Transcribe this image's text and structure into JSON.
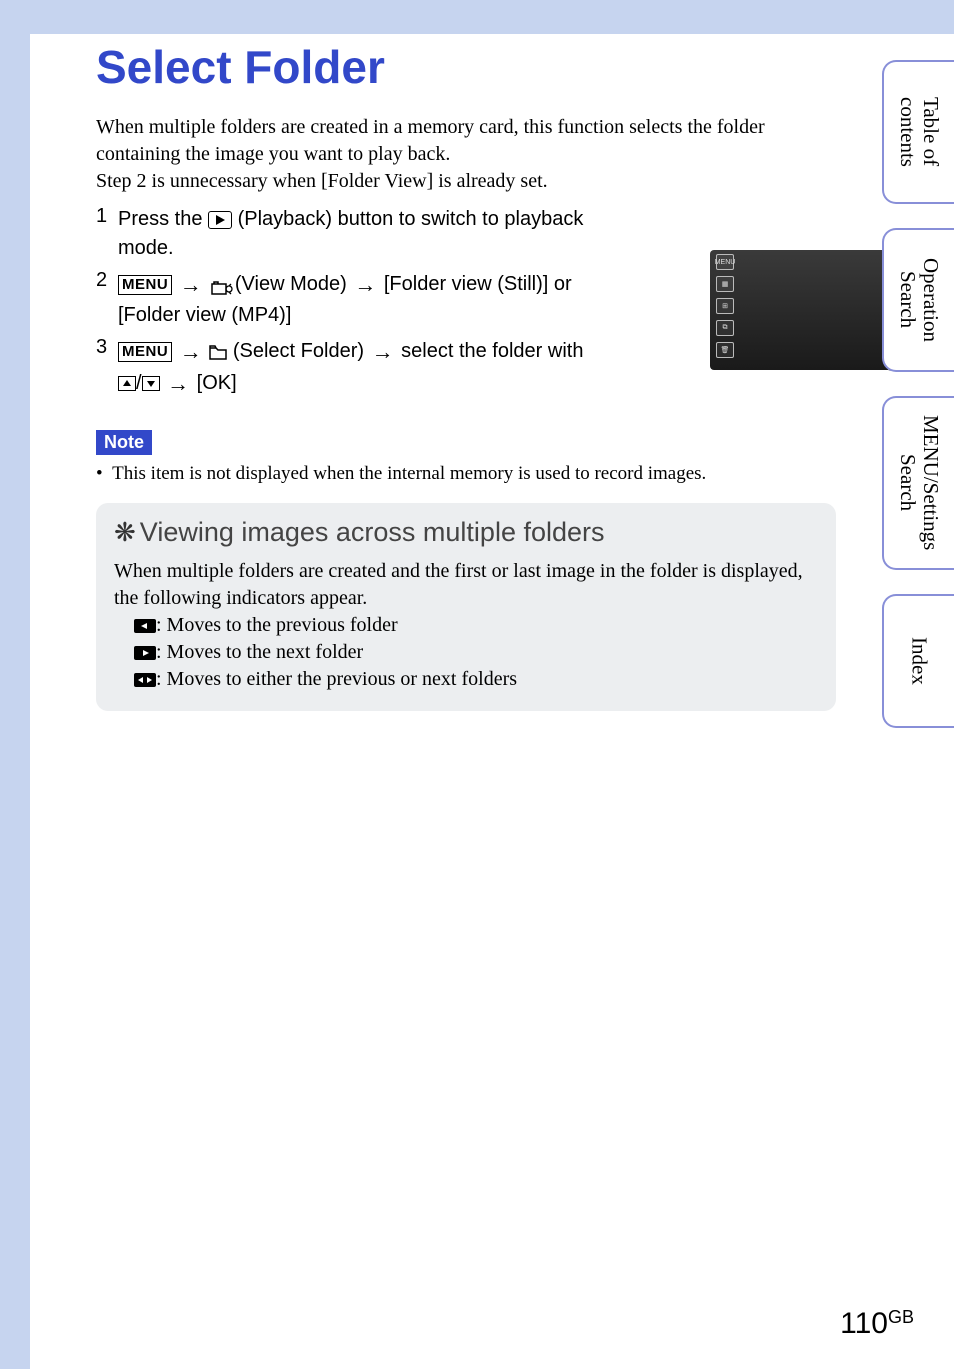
{
  "title": "Select Folder",
  "intro_line1": "When multiple folders are created in a memory card, this function selects the folder containing the image you want to play back.",
  "intro_line2": "Step 2 is unnecessary when [Folder View] is already set.",
  "steps": {
    "s1": {
      "num": "1",
      "pre": "Press the ",
      "post": " (Playback) button to switch to playback mode."
    },
    "s2": {
      "num": "2",
      "menu": "MENU",
      "part1": " (View Mode) ",
      "part2": " [Folder view (Still)] or [Folder view (MP4)]"
    },
    "s3": {
      "num": "3",
      "menu": "MENU",
      "part1": " (Select Folder) ",
      "part2": " select the folder with ",
      "part3": " [OK]"
    }
  },
  "note_label": "Note",
  "note_text": "This item is not displayed when the internal memory is used to record images.",
  "tip": {
    "title": "Viewing images across multiple folders",
    "body": "When multiple folders are created and the first or last image in the folder is displayed, the following indicators appear.",
    "ind_prev": ": Moves to the previous folder",
    "ind_next": ": Moves to the next folder",
    "ind_both": ": Moves to either the previous or next folders"
  },
  "tabs": {
    "t1": "Table of contents",
    "t2": "Operation Search",
    "t3": "MENU/Settings Search",
    "t4": "Index"
  },
  "footer": {
    "page": "110",
    "suffix": "GB"
  }
}
